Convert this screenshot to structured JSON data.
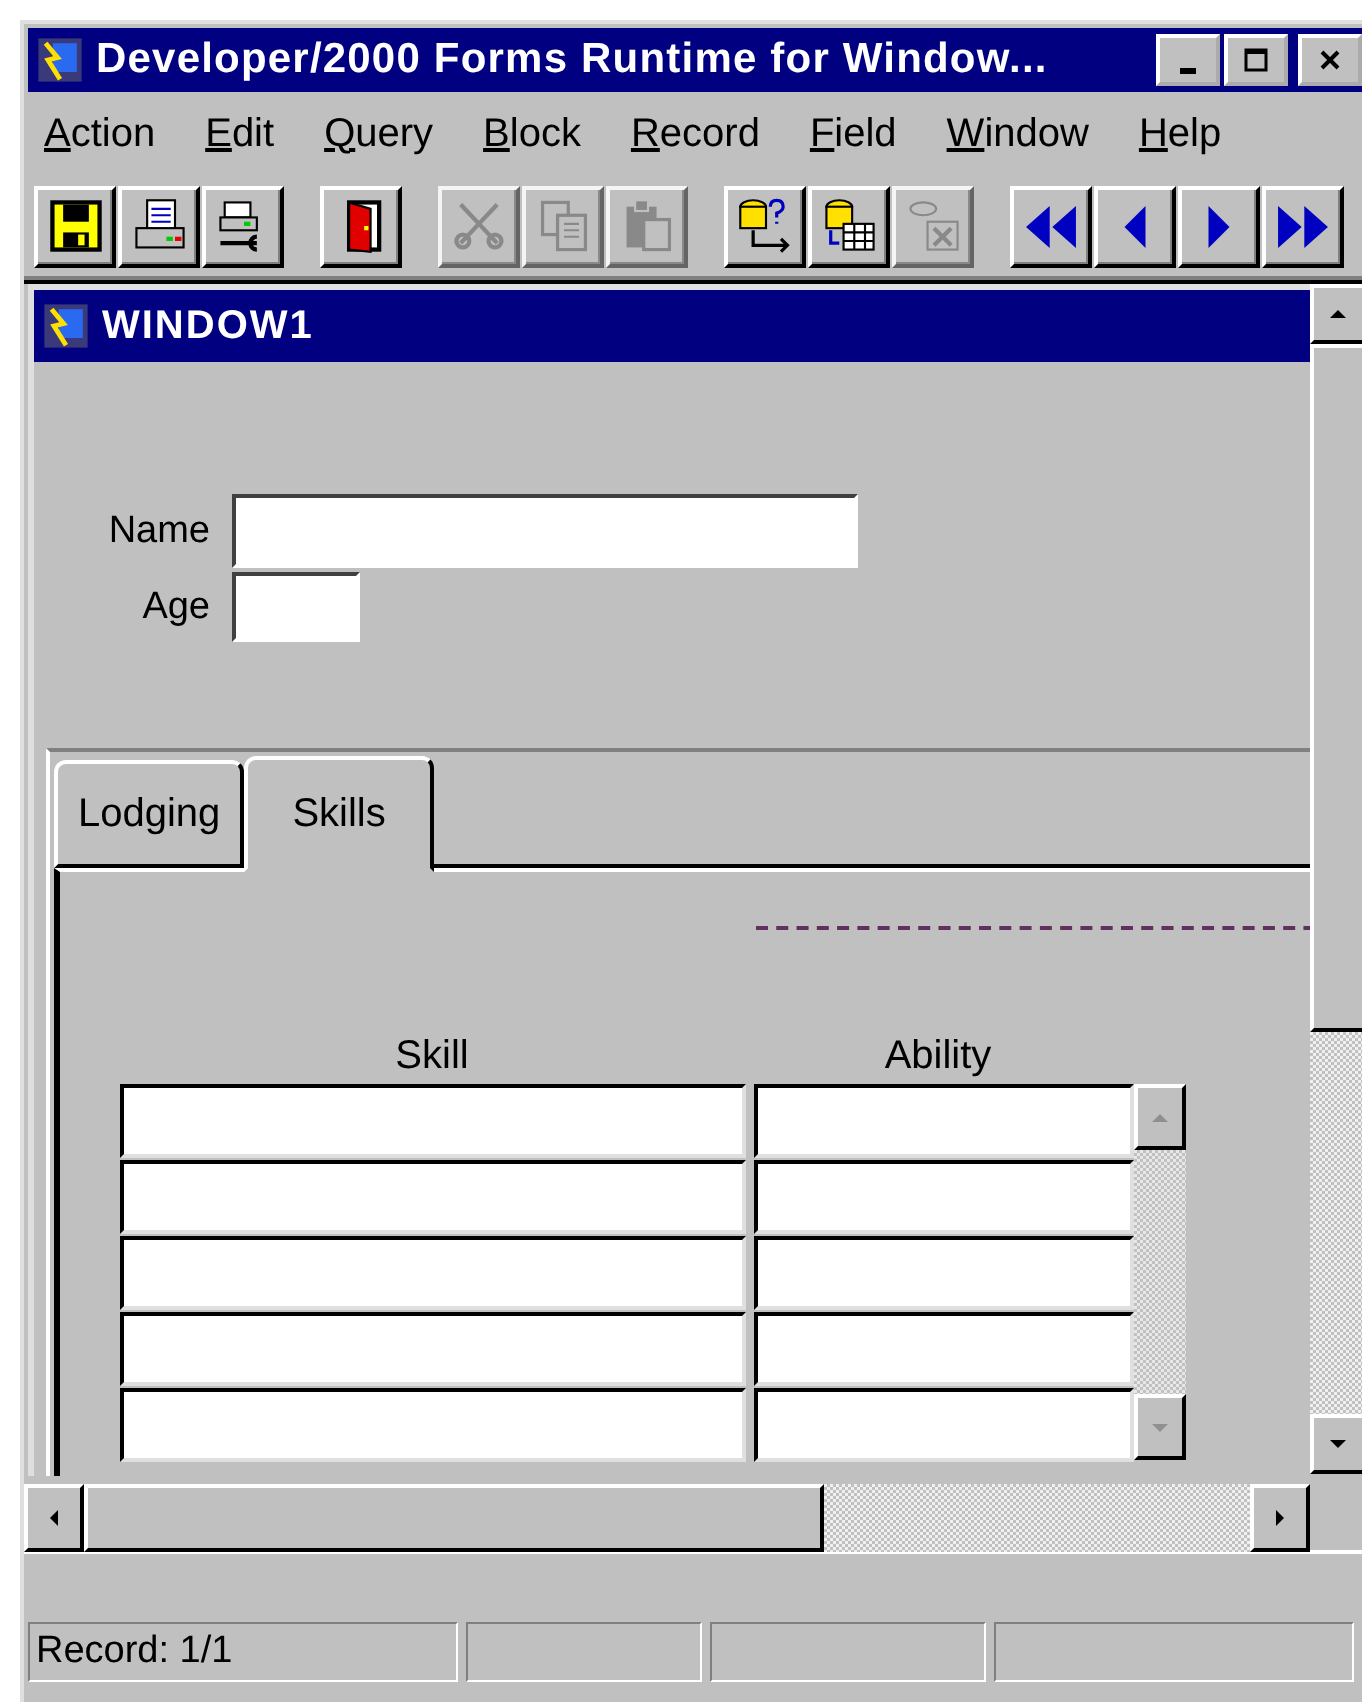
{
  "window": {
    "title": "Developer/2000 Forms Runtime for Window..."
  },
  "menu": [
    "Action",
    "Edit",
    "Query",
    "Block",
    "Record",
    "Field",
    "Window",
    "Help"
  ],
  "toolbar": [
    [
      {
        "kind": "save",
        "disabled": false
      },
      {
        "kind": "print",
        "disabled": false
      },
      {
        "kind": "print_setup",
        "disabled": false
      }
    ],
    [
      {
        "kind": "exit",
        "disabled": false
      }
    ],
    [
      {
        "kind": "cut",
        "disabled": true
      },
      {
        "kind": "copy",
        "disabled": true
      },
      {
        "kind": "paste",
        "disabled": true
      }
    ],
    [
      {
        "kind": "enter_query",
        "disabled": false
      },
      {
        "kind": "execute_query",
        "disabled": false
      },
      {
        "kind": "cancel_query",
        "disabled": true
      }
    ],
    [
      {
        "kind": "first",
        "disabled": false
      },
      {
        "kind": "previous",
        "disabled": false
      },
      {
        "kind": "next",
        "disabled": false
      },
      {
        "kind": "last",
        "disabled": false
      }
    ]
  ],
  "inner_window": {
    "title": "WINDOW1"
  },
  "fields": [
    {
      "kind": "name",
      "label": "Name"
    },
    {
      "kind": "age",
      "label": "Age"
    }
  ],
  "tabs": [
    {
      "label": "Lodging",
      "selected": false
    },
    {
      "label": "Skills",
      "selected": true
    }
  ],
  "table": {
    "columns": [
      "Skill",
      "Ability"
    ]
  },
  "status_bar": [
    "Record: 1/1"
  ]
}
